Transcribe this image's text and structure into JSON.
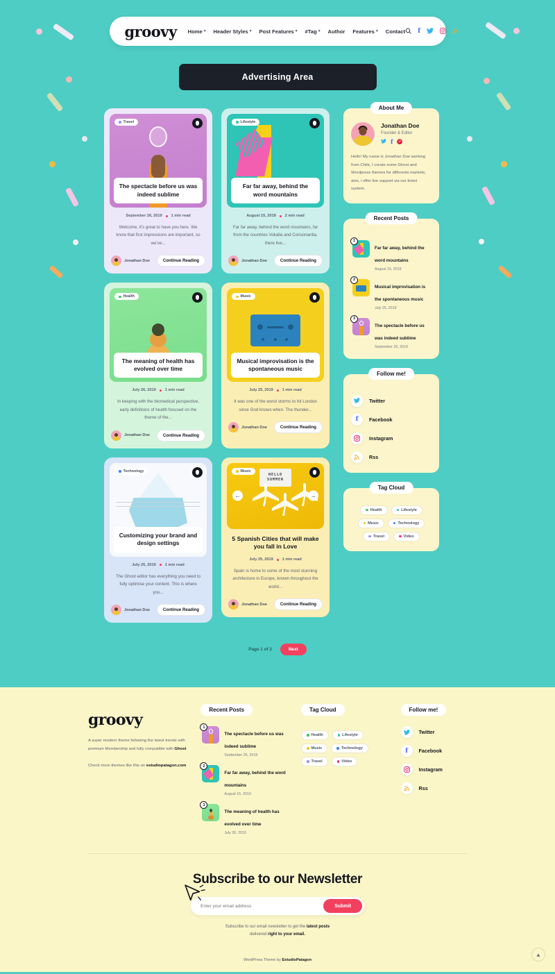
{
  "site": {
    "logo": "groovy"
  },
  "nav": {
    "items": [
      {
        "label": "Home",
        "caret": true
      },
      {
        "label": "Header Styles",
        "caret": true
      },
      {
        "label": "Post Features",
        "caret": true
      },
      {
        "label": "#Tag",
        "caret": true
      },
      {
        "label": "Author",
        "caret": false
      },
      {
        "label": "Features",
        "caret": true
      },
      {
        "label": "Contact",
        "caret": false
      }
    ],
    "icons": [
      {
        "name": "search-icon",
        "glyph": "⌕"
      },
      {
        "name": "facebook-icon",
        "glyph": "f"
      },
      {
        "name": "twitter-icon",
        "glyph": "ᴠ"
      },
      {
        "name": "instagram-icon",
        "glyph": "▣"
      },
      {
        "name": "rss-icon",
        "glyph": "◔"
      }
    ]
  },
  "ad": {
    "label": "Advertising Area"
  },
  "posts": [
    {
      "tag": "Travel",
      "tag_color": "#9b8cf0",
      "title": "The spectacle before us was indeed sublime",
      "date": "September 26, 2019",
      "read": "1 min read",
      "excerpt": "Welcome, it’s great to have you here. We know that first impressions are important, so we’ve...",
      "author": "Jonathan Doe",
      "cta": "Continue Reading",
      "card_bg": "#ece8fa",
      "art": "lightbulb",
      "title_in_image": true
    },
    {
      "tag": "Lifestyle",
      "tag_color": "#2ec4b6",
      "title": "Far far away, behind the word mountains",
      "date": "August 15, 2019",
      "read": "2 min read",
      "excerpt": "Far far away, behind the word mountains, far from the countries Vokalia and Consonantia, there live...",
      "author": "Jonathan Doe",
      "cta": "Continue Reading",
      "card_bg": "#cdf0ec",
      "art": "one",
      "title_in_image": true
    },
    {
      "tag": "Health",
      "tag_color": "#3cc758",
      "title": "The meaning of health has evolved over time",
      "date": "July 26, 2019",
      "read": "1 min read",
      "excerpt": "In keeping with the biomedical perspective, early definitions of health focused on the theme of the...",
      "author": "Jonathan Doe",
      "cta": "Continue Reading",
      "card_bg": "#d4f5dc",
      "art": "gourd",
      "title_in_image": true
    },
    {
      "tag": "Music",
      "tag_color": "#f5c518",
      "title": "Musical improvisation is the spontaneous music",
      "date": "July 25, 2019",
      "read": "1 min read",
      "excerpt": "It was one of the worst storms to hit London since God knows when. The thunder...",
      "author": "Jonathan Doe",
      "cta": "Continue Reading",
      "card_bg": "#fbeeb5",
      "art": "tape",
      "title_in_image": true
    },
    {
      "tag": "Technology",
      "tag_color": "#3b82f6",
      "title": "Customizing your brand and design settings",
      "date": "July 25, 2019",
      "read": "1 min read",
      "excerpt": "The Ghost editor has everything you need to fully optimise your content. This is where you...",
      "author": "Jonathan Doe",
      "cta": "Continue Reading",
      "card_bg": "#d8e4f7",
      "art": "iceberg",
      "title_in_image": true
    },
    {
      "tag": "Music",
      "tag_color": "#f5c518",
      "title": "5 Spanish Cities that will make you fall in Love",
      "date": "July 25, 2019",
      "read": "1 min read",
      "excerpt": "Spain is home to some of the most stunning architecture in Europe, known throughout the world...",
      "author": "Jonathan Doe",
      "cta": "Continue Reading",
      "card_bg": "#fbeeb5",
      "art": "planes",
      "title_in_image": false,
      "sign_line1": "HELLO",
      "sign_line2": "SUMMER",
      "prev_arrow": "←",
      "next_arrow": "→"
    }
  ],
  "sidebar": {
    "about": {
      "title": "About Me",
      "name": "Jonathan Doe",
      "role": "Founder & Editor",
      "socials": [
        {
          "name": "twitter-icon",
          "glyph": "ᴠ",
          "color": "#35b7f2"
        },
        {
          "name": "facebook-icon",
          "glyph": "f",
          "color": "#4267f0"
        },
        {
          "name": "pinterest-icon",
          "glyph": "ⓟ",
          "color": "#e60023"
        }
      ],
      "text": "Hello! My name is Jonathan Doe working from Chile, I create some Ghost and Wordpress themes for differents markets, also, i offer live support via our ticket system."
    },
    "recent": {
      "title": "Recent Posts",
      "items": [
        {
          "num": "1",
          "title": "Far far away, behind the word mountains",
          "date": "August 15, 2019",
          "art": "one"
        },
        {
          "num": "2",
          "title": "Musical improvisation is the spontaneous music",
          "date": "July 25, 2019",
          "art": "tape"
        },
        {
          "num": "3",
          "title": "The spectacle before us was indeed sublime",
          "date": "September 26, 2019",
          "art": "lightbulb"
        }
      ]
    },
    "follow": {
      "title": "Follow me!",
      "items": [
        {
          "label": "Twitter",
          "name": "twitter-icon",
          "glyph": "ᴠ",
          "color": "#35b7f2"
        },
        {
          "label": "Facebook",
          "name": "facebook-icon",
          "glyph": "f",
          "color": "#4267f0"
        },
        {
          "label": "Instagram",
          "name": "instagram-icon",
          "glyph": "▣",
          "color": "#e1306c"
        },
        {
          "label": "Rss",
          "name": "rss-icon",
          "glyph": "◔",
          "color": "#f5a623"
        }
      ]
    },
    "tags": {
      "title": "Tag Cloud",
      "items": [
        {
          "label": "Health",
          "color": "#3cc758"
        },
        {
          "label": "Lifestyle",
          "color": "#2ec4b6"
        },
        {
          "label": "Music",
          "color": "#f5c518"
        },
        {
          "label": "Technology",
          "color": "#3b82f6"
        },
        {
          "label": "Travel",
          "color": "#9b8cf0"
        },
        {
          "label": "Video",
          "color": "#ec2f8a"
        }
      ]
    }
  },
  "pagination": {
    "label": "Page 1 of 2",
    "next": "Next"
  },
  "footer": {
    "logo": "groovy",
    "desc_1": "A super modern theme following the latest trends with premium Membership and fully compatible with ",
    "desc_1_b": "Ghost",
    "desc_2": "Check more themes like this on ",
    "desc_2_b": "estudiopatagon.com",
    "recent": {
      "title": "Recent Posts",
      "items": [
        {
          "num": "1",
          "title": "The spectacle before us was indeed sublime",
          "date": "September 26, 2019",
          "art": "lightbulb"
        },
        {
          "num": "2",
          "title": "Far far away, behind the word mountains",
          "date": "August 15, 2019",
          "art": "one"
        },
        {
          "num": "3",
          "title": "The meaning of health has evolved over time",
          "date": "July 26, 2019",
          "art": "gourd"
        }
      ]
    },
    "tags": {
      "title": "Tag Cloud",
      "items": [
        {
          "label": "Health",
          "color": "#3cc758"
        },
        {
          "label": "Lifestyle",
          "color": "#2ec4b6"
        },
        {
          "label": "Music",
          "color": "#f5c518"
        },
        {
          "label": "Technology",
          "color": "#3b82f6"
        },
        {
          "label": "Travel",
          "color": "#9b8cf0"
        },
        {
          "label": "Video",
          "color": "#ec2f8a"
        }
      ]
    },
    "follow": {
      "title": "Follow me!",
      "items": [
        {
          "label": "Twitter",
          "name": "twitter-icon",
          "glyph": "ᴠ",
          "color": "#35b7f2"
        },
        {
          "label": "Facebook",
          "name": "facebook-icon",
          "glyph": "f",
          "color": "#4267f0"
        },
        {
          "label": "Instagram",
          "name": "instagram-icon",
          "glyph": "▣",
          "color": "#e1306c"
        },
        {
          "label": "Rss",
          "name": "rss-icon",
          "glyph": "◔",
          "color": "#f5a623"
        }
      ]
    },
    "newsletter": {
      "title": "Subscribe to our Newsletter",
      "placeholder": "Enter your email address",
      "submit": "Submit",
      "note_1": "Subscribe to our email newsletter to get the ",
      "note_1_b": "latest posts",
      "note_2": " delivered ",
      "note_2_b": "right to your email."
    },
    "copyright_1": "WordPress Theme by ",
    "copyright_b": "EstudioPatagon",
    "to_top": "▲"
  },
  "colors": {
    "page_bg": "#4ecdc4",
    "footer_bg": "#fbf6c8",
    "accent_red": "#f2415f",
    "widget_bg": "#fcf5cb",
    "dark": "#1c2029"
  }
}
